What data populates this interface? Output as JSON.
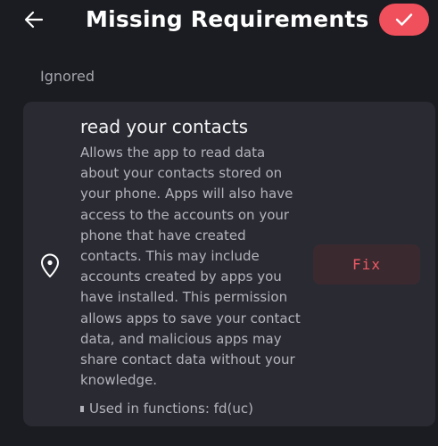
{
  "header": {
    "title": "Missing Requirements",
    "back_icon": "arrow-left-icon",
    "confirm_icon": "check-icon",
    "accent_color": "#f0505c"
  },
  "section": {
    "label": "Ignored"
  },
  "permissions": [
    {
      "icon": "location-pin-icon",
      "title": "read your contacts",
      "description": "Allows the app to read data about your contacts stored on your phone. Apps will also have access to the accounts on your phone that have created contacts. This may include accounts created by apps you have installed. This permission allows apps to save your contact data, and malicious apps may share contact data without your knowledge.",
      "used_in": "Used in functions: fd(uc)",
      "fix_label": "Fix"
    }
  ]
}
